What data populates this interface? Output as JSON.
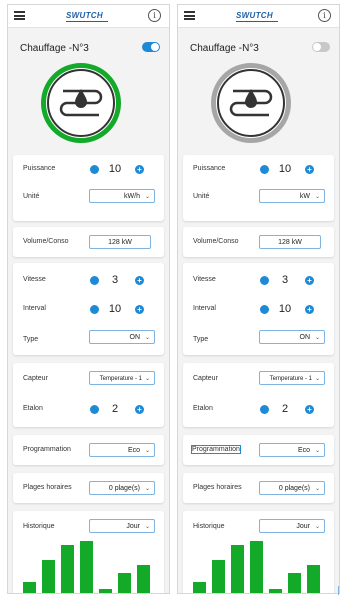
{
  "brand": "SWUTCH",
  "info_glyph": "i",
  "icons": {
    "menu": "menu-icon",
    "info": "info-icon",
    "heater": "heater-icon",
    "chevron": "chevron-down-icon"
  },
  "colors": {
    "accent": "#1e8ad6",
    "active_ring": "#13aa2a",
    "inactive_ring": "#a6a6a6",
    "bars": "#13aa2a"
  },
  "panels": [
    {
      "title": "Chauffage -N°3",
      "enabled": true,
      "puissance": {
        "label": "Puissance",
        "value": "10"
      },
      "unite": {
        "label": "Unité",
        "value": "kW/h"
      },
      "volume": {
        "label": "Volume/Conso",
        "value": "128 kW"
      },
      "vitesse": {
        "label": "Vitesse",
        "value": "3"
      },
      "interval": {
        "label": "Interval",
        "value": "10"
      },
      "type": {
        "label": "Type",
        "value": "ON"
      },
      "capteur": {
        "label": "Capteur",
        "value": "Temperature - 1"
      },
      "etalon": {
        "label": "Etalon",
        "value": "2"
      },
      "programmation": {
        "label": "Programmation",
        "value": "Eco"
      },
      "plages": {
        "label": "Plages horaires",
        "value": "0 plage(s)"
      },
      "historique": {
        "label": "Historique",
        "value": "Jour",
        "bars": [
          12,
          32,
          46,
          50,
          6,
          20,
          28
        ]
      }
    },
    {
      "title": "Chauffage -N°3",
      "enabled": false,
      "puissance": {
        "label": "Puissance",
        "value": "10"
      },
      "unite": {
        "label": "Unité",
        "value": "kW"
      },
      "volume": {
        "label": "Volume/Conso",
        "value": "128 kW"
      },
      "vitesse": {
        "label": "Vitesse",
        "value": "3"
      },
      "interval": {
        "label": "Interval",
        "value": "10"
      },
      "type": {
        "label": "Type",
        "value": "ON"
      },
      "capteur": {
        "label": "Capteur",
        "value": "Temperature - 1"
      },
      "etalon": {
        "label": "Etalon",
        "value": "2"
      },
      "programmation": {
        "label": "Programmation",
        "value": "Eco"
      },
      "plages": {
        "label": "Plages horaires",
        "value": "0 plage(s)"
      },
      "historique": {
        "label": "Historique",
        "value": "Jour",
        "bars": [
          12,
          32,
          46,
          50,
          6,
          20,
          28
        ]
      }
    }
  ]
}
